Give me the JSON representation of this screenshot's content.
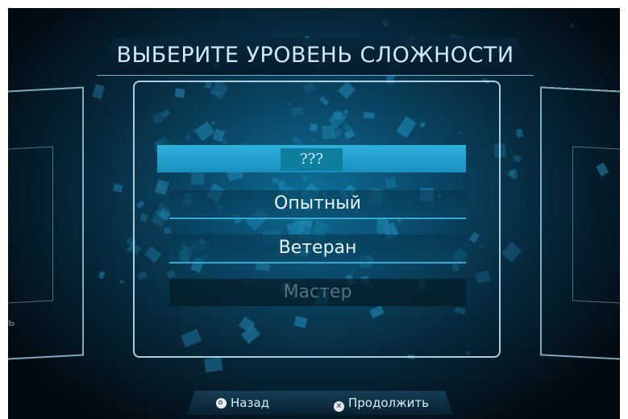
{
  "title": "ВЫБЕРИТЕ УРОВЕНЬ СЛОЖНОСТИ",
  "difficulty_options": [
    {
      "label": "???",
      "state": "selected"
    },
    {
      "label": "Опытный",
      "state": "available"
    },
    {
      "label": "Ветеран",
      "state": "available"
    },
    {
      "label": "Мастер",
      "state": "locked"
    }
  ],
  "side_left_text": "ь",
  "footer": {
    "back_label": "Назад",
    "continue_label": "Продолжить",
    "back_icon": "circle-button-icon",
    "continue_icon": "cross-button-icon"
  },
  "colors": {
    "accent": "#31b1dc",
    "background": "#062638",
    "text": "#e8f6fc"
  }
}
